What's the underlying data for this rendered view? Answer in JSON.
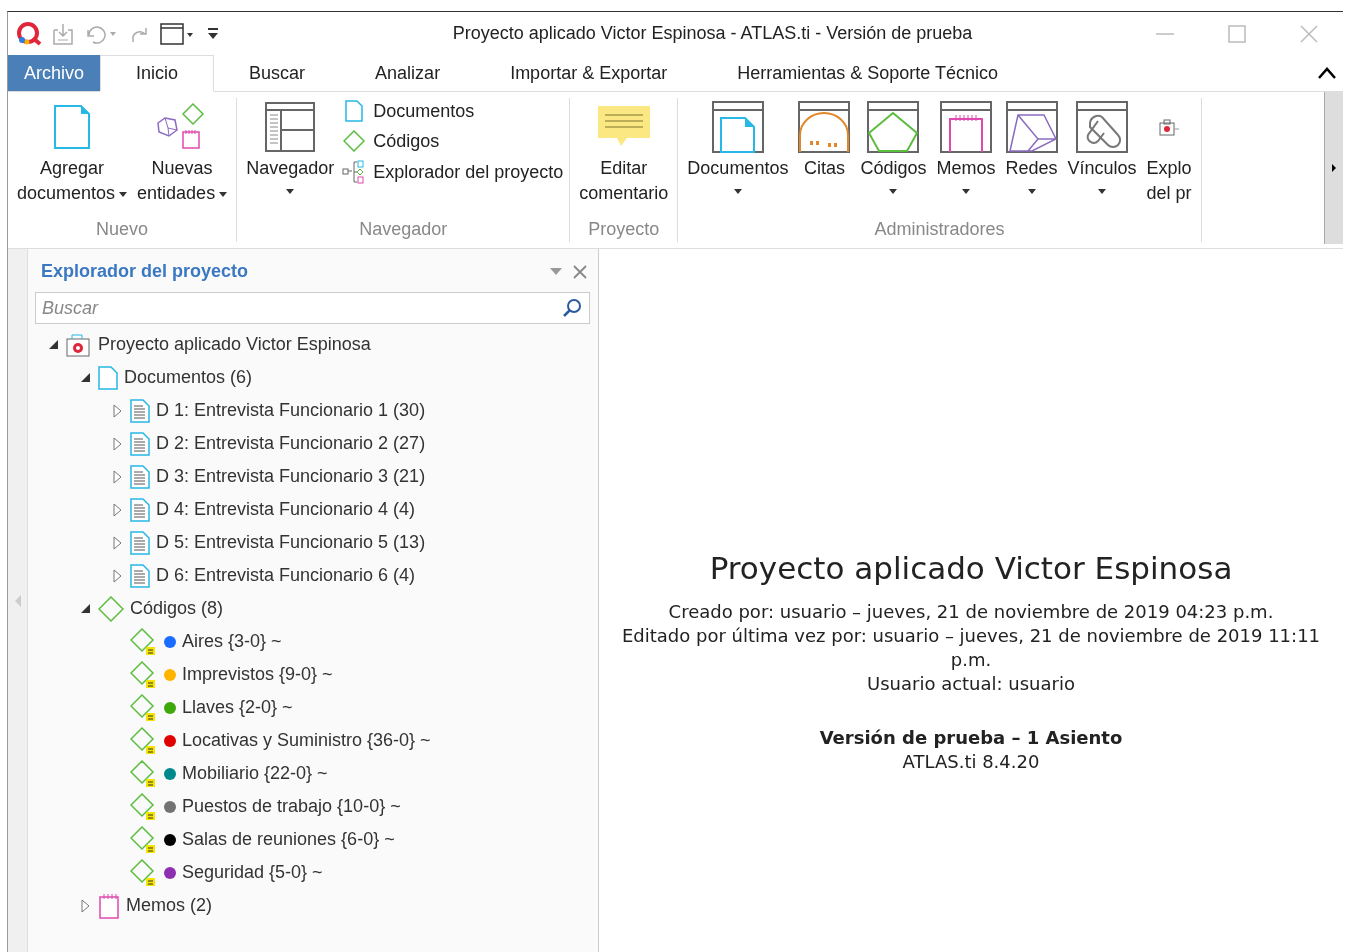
{
  "window": {
    "title": "Proyecto aplicado Victor Espinosa - ATLAS.ti - Versión de prueba"
  },
  "tabs": [
    {
      "label": "Archivo",
      "kind": "file",
      "selected": false
    },
    {
      "label": "Inicio",
      "kind": "tab",
      "selected": true
    },
    {
      "label": "Buscar",
      "kind": "tab",
      "selected": false
    },
    {
      "label": "Analizar",
      "kind": "tab",
      "selected": false
    },
    {
      "label": "Importar & Exportar",
      "kind": "tab",
      "selected": false
    },
    {
      "label": "Herramientas & Soporte Técnico",
      "kind": "tab",
      "selected": false
    }
  ],
  "ribbon": [
    {
      "label": "Nuevo",
      "items": [
        {
          "kind": "document",
          "lines": [
            "Agregar",
            "documentos"
          ],
          "dropdown": true
        },
        {
          "kind": "entities",
          "lines": [
            "Nuevas",
            "entidades"
          ],
          "dropdown": true
        }
      ]
    },
    {
      "label": "Navegador",
      "items": [
        {
          "kind": "navigator",
          "lines": [
            "Navegador"
          ],
          "dropdown": true
        },
        {
          "kind": "stack",
          "entries": [
            {
              "kind": "document",
              "label": "Documentos"
            },
            {
              "kind": "code",
              "label": "Códigos"
            },
            {
              "kind": "explorer",
              "label": "Explorador del proyecto"
            }
          ]
        }
      ]
    },
    {
      "label": "Proyecto",
      "items": [
        {
          "kind": "comment",
          "lines": [
            "Editar",
            "comentario"
          ],
          "dropdown": false
        }
      ]
    },
    {
      "label": "Administradores",
      "items": [
        {
          "kind": "documents",
          "lines": [
            "Documentos"
          ],
          "dropdown": true
        },
        {
          "kind": "quotes",
          "lines": [
            "Citas"
          ],
          "dropdown": false
        },
        {
          "kind": "codes",
          "lines": [
            "Códigos"
          ],
          "dropdown": true
        },
        {
          "kind": "memos",
          "lines": [
            "Memos"
          ],
          "dropdown": true
        },
        {
          "kind": "networks",
          "lines": [
            "Redes"
          ],
          "dropdown": true
        },
        {
          "kind": "links",
          "lines": [
            "Vínculos"
          ],
          "dropdown": true
        },
        {
          "kind": "explorer",
          "lines": [
            "Explo",
            "del pr"
          ],
          "dropdown": false
        }
      ]
    }
  ],
  "explorer": {
    "title": "Explorador del proyecto",
    "search": {
      "placeholder": "Buscar"
    },
    "tree": [
      {
        "kind": "project",
        "label": "Proyecto aplicado Victor Espinosa",
        "expanded": true,
        "children": [
          {
            "kind": "documents",
            "label": "Documentos (6)",
            "expanded": true,
            "children": [
              {
                "kind": "document",
                "label": "D 1: Entrevista Funcionario 1 (30)",
                "expanded": false
              },
              {
                "kind": "document",
                "label": "D 2: Entrevista Funcionario 2 (27)",
                "expanded": false
              },
              {
                "kind": "document",
                "label": "D 3: Entrevista Funcionario 3 (21)",
                "expanded": false
              },
              {
                "kind": "document",
                "label": "D 4: Entrevista Funcionario 4 (4)",
                "expanded": false
              },
              {
                "kind": "document",
                "label": "D 5: Entrevista Funcionario 5 (13)",
                "expanded": false
              },
              {
                "kind": "document",
                "label": "D 6: Entrevista Funcionario 6 (4)",
                "expanded": false
              }
            ]
          },
          {
            "kind": "codes",
            "label": "Códigos (8)",
            "expanded": true,
            "children": [
              {
                "kind": "code",
                "label": "Aires {3-0} ~",
                "color": "#1a6dff"
              },
              {
                "kind": "code",
                "label": "Imprevistos {9-0} ~",
                "color": "#ffb400"
              },
              {
                "kind": "code",
                "label": "Llaves {2-0} ~",
                "color": "#3fa80a"
              },
              {
                "kind": "code",
                "label": "Locativas y Suministro {36-0} ~",
                "color": "#e00000"
              },
              {
                "kind": "code",
                "label": "Mobiliario {22-0} ~",
                "color": "#00888c"
              },
              {
                "kind": "code",
                "label": "Puestos de trabajo {10-0} ~",
                "color": "#737373"
              },
              {
                "kind": "code",
                "label": "Salas de reuniones {6-0} ~",
                "color": "#000000"
              },
              {
                "kind": "code",
                "label": "Seguridad {5-0} ~",
                "color": "#8e2fb0"
              }
            ]
          },
          {
            "kind": "memos",
            "label": "Memos (2)",
            "expanded": false
          }
        ]
      }
    ]
  },
  "project_info": {
    "title": "Proyecto aplicado Victor Espinosa",
    "lines": [
      "Creado por: usuario – jueves, 21 de noviembre de 2019 04:23 p.m.",
      "Editado por última vez por: usuario – jueves, 21 de noviembre de 2019 11:11 p.m.",
      "Usuario actual: usuario"
    ],
    "license": "Versión de prueba – 1 Asiento",
    "version": "ATLAS.ti 8.4.20"
  }
}
